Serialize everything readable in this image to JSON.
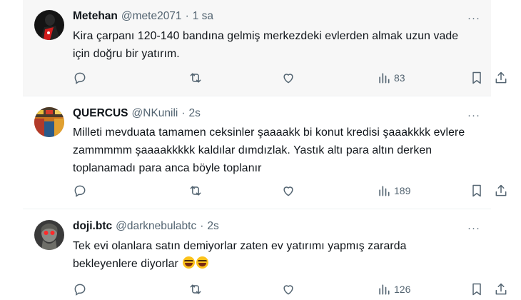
{
  "tweets": [
    {
      "name": "Metehan",
      "handle": "@mete2071",
      "time": "1 sa",
      "text": "Kira çarpanı 120-140 bandına gelmiş merkezdeki evlerden almak uzun vade için doğru bir yatırım.",
      "views": "83",
      "avatar_icon": "red-scarf-portrait"
    },
    {
      "name": "QUERCUS",
      "handle": "@NKunili",
      "time": "2s",
      "text": "Milleti mevduata tamamen ceksinler şaaaakk bi konut kredisi şaaakkkk evlere zammmmm şaaaakkkkk kaldılar dımdızlak. Yastık altı para altın derken toplanamadı para anca böyle toplanır",
      "views": "189",
      "avatar_icon": "colorful-market-photo"
    },
    {
      "name": "doji.btc",
      "handle": "@darknebulabtc",
      "time": "2s",
      "text": "Tek evi olanlara satın demiyorlar zaten ev yatırımı yapmış zararda bekleyenlere diyorlar",
      "emoji": "😂😂",
      "views": "126",
      "avatar_icon": "red-eyed-statue"
    }
  ],
  "separator": "·",
  "more_glyph": "···",
  "icons": [
    "reply-icon",
    "retweet-icon",
    "like-icon",
    "views-icon",
    "bookmark-icon",
    "share-icon"
  ],
  "colors": {
    "text": "#0f1419",
    "secondary": "#536471",
    "highlight_bg": "#f7f7f7"
  }
}
